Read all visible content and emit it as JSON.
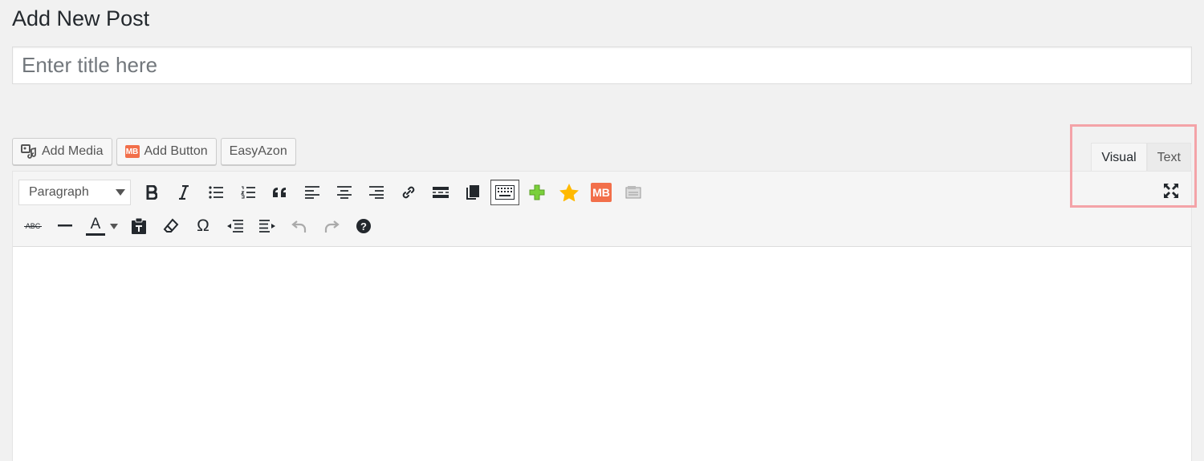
{
  "page": {
    "title": "Add New Post"
  },
  "title_field": {
    "placeholder": "Enter title here",
    "value": ""
  },
  "media_buttons": [
    {
      "label": "Add Media",
      "icon": "media-icon"
    },
    {
      "label": "Add Button",
      "icon": "mb-logo-icon",
      "badge": "MB"
    },
    {
      "label": "EasyAzon"
    }
  ],
  "editor_tabs": {
    "visual": "Visual",
    "text": "Text",
    "active": "visual"
  },
  "toolbar": {
    "format_value": "Paragraph",
    "row1_icons": [
      "bold-icon",
      "italic-icon",
      "bulleted-list-icon",
      "numbered-list-icon",
      "blockquote-icon",
      "align-left-icon",
      "align-center-icon",
      "align-right-icon",
      "link-icon",
      "read-more-icon",
      "copy-icon",
      "toolbar-toggle-icon",
      "plus-icon",
      "star-icon",
      "mb-icon",
      "media-placeholder-icon"
    ],
    "row2_icons": [
      "strikethrough-icon",
      "horizontal-line-icon",
      "text-color-icon",
      "paste-text-icon",
      "clear-formatting-icon",
      "special-character-icon",
      "outdent-icon",
      "indent-icon",
      "undo-icon",
      "redo-icon",
      "help-icon"
    ],
    "mb_badge": "MB",
    "strike_label": "ABC",
    "color_label": "A",
    "omega": "Ω",
    "help": "?"
  },
  "colors": {
    "accent_plus": "#7ad03a",
    "star": "#ffb900",
    "mb": "#f26f4a",
    "highlight": "#f4a3a8"
  }
}
